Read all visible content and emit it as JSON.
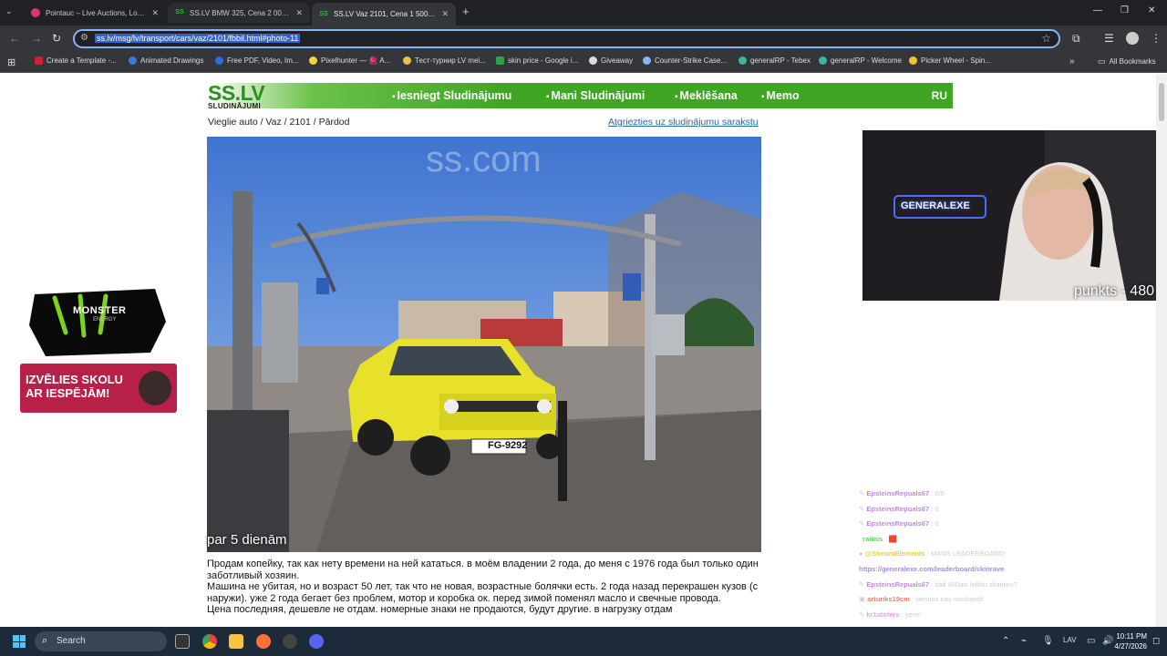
{
  "browser": {
    "tabs": [
      {
        "title": "Pointauc – Live Auctions, Lottery",
        "active": false
      },
      {
        "title": "SS.LV BMW 325, Cena 2 000 €. P",
        "active": false
      },
      {
        "title": "SS.LV Vaz 2101, Cena 1 500 €. P",
        "active": true
      }
    ],
    "url": "ss.lv/msg/lv/transport/cars/vaz/2101/fbbil.html#photo-11",
    "bookmarks": [
      "Create a Template -...",
      "Animated Drawings",
      "Free PDF, Video, Im...",
      "Pixelhunter — 🧶 A...",
      "Тест-турнир LV mei...",
      "skin price - Google i...",
      "Giveaway",
      "Counter-Strike Case...",
      "generalRP - Tebex",
      "generalRP - Welcome",
      "Picker Wheel - Spin..."
    ],
    "all_bookmarks": "All Bookmarks"
  },
  "site": {
    "logo": "SS.LV",
    "logo_sub": "SLUDINĀJUMI",
    "nav": [
      "Iesniegt Sludinājumu",
      "Mani Sludinājumi",
      "Meklēšana",
      "Memo"
    ],
    "lang": "RU",
    "breadcrumb": "Vieglie auto / Vaz / 2101 / Pārdod",
    "back_link": "Atgriezties uz sludinājumu sarakstu",
    "photo_caption": "par 5 dienām",
    "plate": "FG-9292",
    "watermark": "ss.com",
    "description": [
      "Продам копейку, так как нету времени на ней кататься. в моём владении 2 года, до меня с 1976 года был только один заботливый хозяин.",
      "Машина не убитая, но и возраст 50 лет, так что не новая, возрастные болячки есть. 2 года назад перекрашен кузов (с наружи). уже 2 года бегает без проблем, мотор и коробка ок. перед зимой поменял масло и свечные провода.",
      "Цена последняя, дешевле не отдам. номерные знаки не продаются, будут другие. в нагрузку отдам"
    ]
  },
  "overlay": {
    "monster_brand": "MONSTER",
    "monster_sub": "ENERGY",
    "ad_skolu": [
      "IZVĒLIES SKOLU",
      "AR IESPĒJĀM!"
    ],
    "neon_sign": "GENERALEXE",
    "cam_label": "punkts - 480",
    "chat": [
      {
        "user": "EpsteinsRepuals67",
        "text": ": 0/0",
        "color": "#c08ad8"
      },
      {
        "user": "EpsteinsRepuals67",
        "text": ": 0",
        "color": "#c08ad8"
      },
      {
        "user": "EpsteinsRepuals67",
        "text": ": 0",
        "color": "#c08ad8"
      },
      {
        "user": "raiinis",
        "text": ": 🟥",
        "color": "#5fd35f"
      },
      {
        "user": "@StreamElements",
        "text": ": MANS LEADERBOARD",
        "color": "#e7d23b"
      },
      {
        "user": "https://generalexe.com/leaderboard/skinrave",
        "text": "",
        "color": "#a58ce8"
      },
      {
        "user": "EpsteinsRepuals67",
        "text": ": kad 450ais ieliktu skatijies?",
        "color": "#c08ad8"
      },
      {
        "user": "arturiks19cm",
        "text": ": viesnas nav mockwish",
        "color": "#f07c7c"
      },
      {
        "user": "kr1stofers",
        "text": ": yeee",
        "color": "#f0a0e0"
      }
    ]
  },
  "taskbar": {
    "search_placeholder": "Search",
    "lang": "LAV",
    "time": "10:11 PM",
    "date": "4/27/2026"
  }
}
